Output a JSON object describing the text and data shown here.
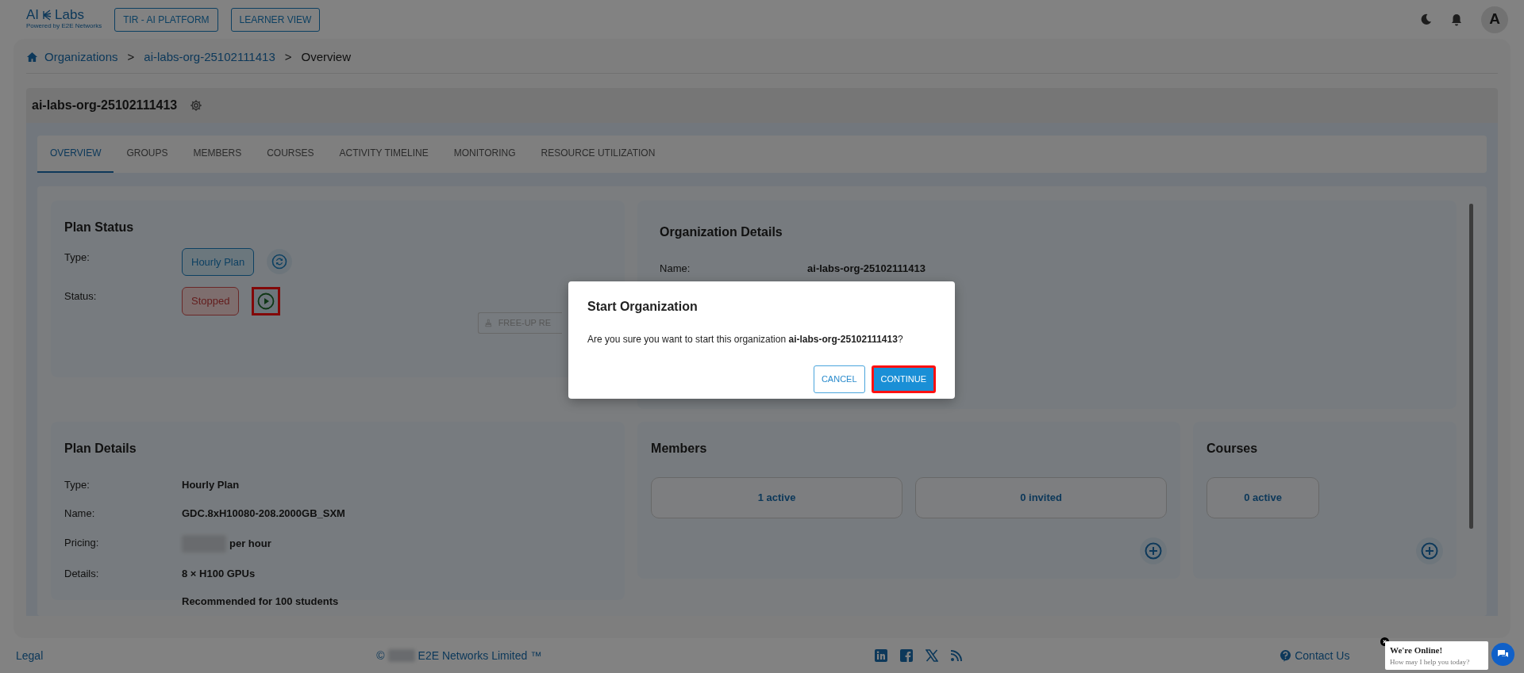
{
  "header": {
    "logo": {
      "left": "AI",
      "right": "Labs",
      "tagline": "Powered by E2E Networks"
    },
    "buttons": [
      "TIR - AI PLATFORM",
      "LEARNER VIEW"
    ],
    "avatar": "A"
  },
  "breadcrumb": {
    "separator": ">",
    "items": [
      {
        "label": "Organizations",
        "link": true
      },
      {
        "label": "ai-labs-org-25102111413",
        "link": true
      },
      {
        "label": "Overview",
        "link": false
      }
    ]
  },
  "org_title": "ai-labs-org-25102111413",
  "tabs": [
    {
      "label": "OVERVIEW",
      "selected": true
    },
    {
      "label": "GROUPS",
      "selected": false
    },
    {
      "label": "MEMBERS",
      "selected": false
    },
    {
      "label": "COURSES",
      "selected": false
    },
    {
      "label": "ACTIVITY TIMELINE",
      "selected": false
    },
    {
      "label": "MONITORING",
      "selected": false
    },
    {
      "label": "RESOURCE UTILIZATION",
      "selected": false
    }
  ],
  "plan_status": {
    "title": "Plan Status",
    "rows": [
      {
        "label": "Type:",
        "badge": "Hourly Plan",
        "kind": "type",
        "highlighted": false
      },
      {
        "label": "Status:",
        "badge": "Stopped",
        "kind": "status",
        "highlighted": true
      }
    ],
    "free_up_button": "FREE-UP RE"
  },
  "organization_details": {
    "title": "Organization Details",
    "fields": [
      {
        "label": "Name:",
        "value": "ai-labs-org-25102111413"
      }
    ]
  },
  "plan_details": {
    "title": "Plan Details",
    "rows": [
      {
        "label": "Type:",
        "values": [
          "Hourly Plan"
        ],
        "redacted": false
      },
      {
        "label": "Name:",
        "values": [
          "GDC.8xH10080-208.2000GB_SXM"
        ],
        "redacted": false
      },
      {
        "label": "Pricing:",
        "values": [
          "per hour"
        ],
        "redacted": true
      },
      {
        "label": "Details:",
        "values": [
          "8 × H100 GPUs",
          "Recommended for 100 students"
        ],
        "redacted": false
      }
    ]
  },
  "members": {
    "title": "Members",
    "stats": [
      "1 active",
      "0 invited"
    ]
  },
  "courses": {
    "title": "Courses",
    "stats": [
      "0 active"
    ]
  },
  "modal": {
    "title": "Start Organization",
    "message": "Are you sure you want to start this organization **ai-labs-org-25102111413**?",
    "buttons": [
      {
        "label": "CANCEL",
        "kind": "cancel",
        "highlighted": false
      },
      {
        "label": "CONTINUE",
        "kind": "continue",
        "highlighted": true
      }
    ]
  },
  "footer": {
    "legal": "Legal",
    "copyright_symbol": "©",
    "company": "E2E Networks Limited ™",
    "contact": "Contact Us"
  },
  "chat": {
    "title": "We're Online!",
    "subtitle": "How may I help you today?"
  }
}
